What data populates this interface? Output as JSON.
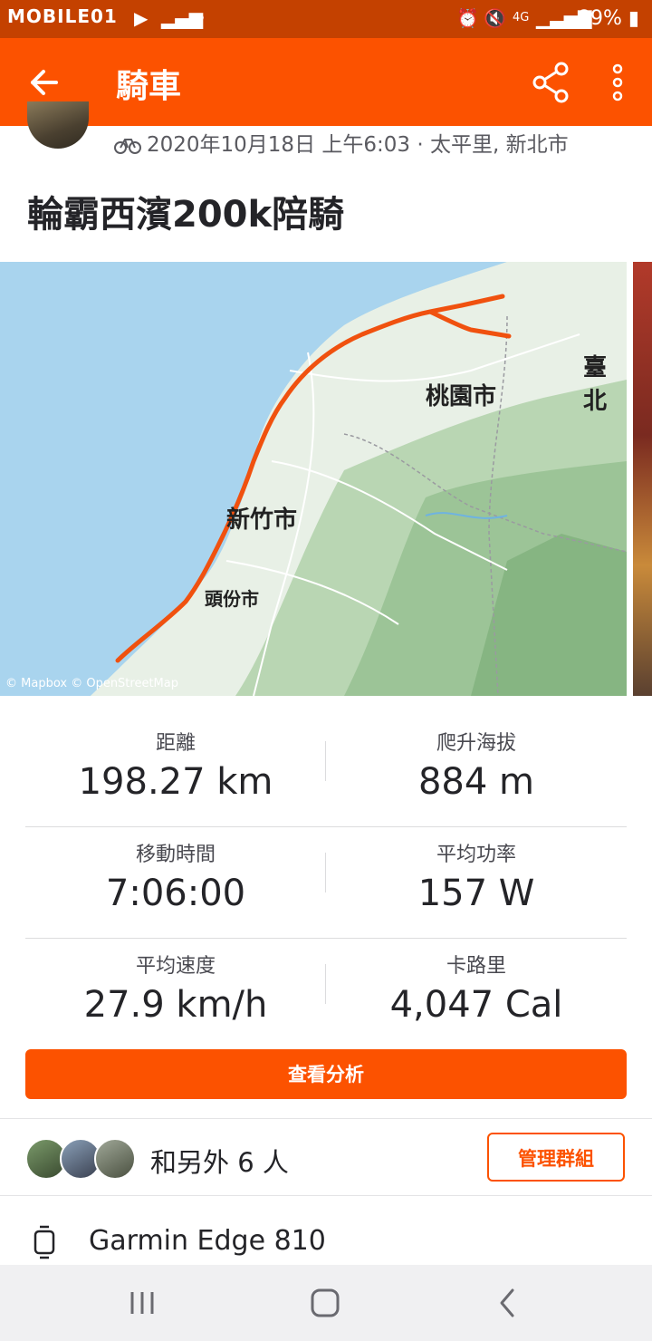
{
  "status_bar": {
    "watermark": "MOBILE01",
    "battery": "89%",
    "network": "4G",
    "color": "#c44100"
  },
  "app_bar": {
    "title": "騎車",
    "color": "#fc5200",
    "icons": [
      "back-arrow-icon",
      "share-icon",
      "more-vertical-icon"
    ]
  },
  "activity": {
    "meta": "2020年10月18日 上午6:03 · 太平里, 新北市",
    "title": "輪霸西濱200k陪騎"
  },
  "map": {
    "labels": {
      "taoyuan": "桃園市",
      "hsinchu": "新竹市",
      "toufen": "頭份市",
      "taipei": "臺北"
    },
    "credit": "© Mapbox © OpenStreetMap",
    "route_color": "#f0510f"
  },
  "stats": [
    {
      "label": "距離",
      "value": "198.27 km"
    },
    {
      "label": "爬升海拔",
      "value": "884 m"
    },
    {
      "label": "移動時間",
      "value": "7:06:00"
    },
    {
      "label": "平均功率",
      "value": "157 W"
    },
    {
      "label": "平均速度",
      "value": "27.9 km/h"
    },
    {
      "label": "卡路里",
      "value": "4,047 Cal"
    }
  ],
  "actions": {
    "analysis": "查看分析",
    "manage_group": "管理群組"
  },
  "group": {
    "text": "和另外 6 人"
  },
  "device": {
    "name": "Garmin Edge 810"
  }
}
